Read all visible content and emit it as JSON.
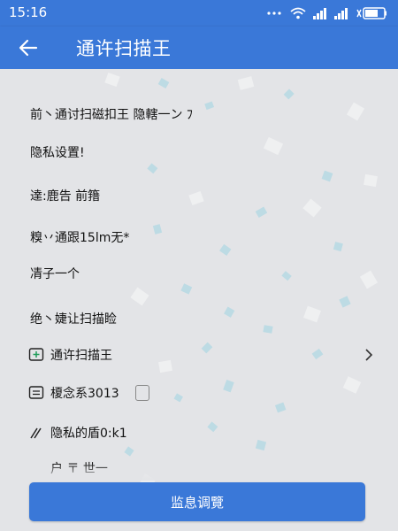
{
  "status_bar": {
    "time": "15:16",
    "icons": [
      "dots-icon",
      "wifi-icon",
      "signal-icon",
      "signal-icon",
      "battery-icon"
    ]
  },
  "app_bar": {
    "title": "通许扫描王",
    "back_icon": "arrow-left-icon"
  },
  "content": {
    "rows": [
      "前丶通讨扫磁扣王 隐轄一ン ﾌ",
      "隐私设置!",
      "達:鹿告 前簎",
      "糗丷通跟15lm无*",
      "凊子一个",
      "绝丶婕让扫描睑"
    ],
    "items": [
      {
        "icon": "plus-box-icon",
        "label": "通许扫描王",
        "has_chevron": true
      },
      {
        "icon": "list-box-icon",
        "label": "榎念系3013",
        "has_toggle": true
      },
      {
        "icon": "slash-icon",
        "label": "隐私的盾0:k1"
      },
      {
        "icon": "cut-off-icon",
        "label": "户 〒 世一"
      }
    ]
  },
  "bottom_button": {
    "label": "监息调覽"
  },
  "colors": {
    "primary": "#3a78d8",
    "background": "#e3e4e7",
    "text": "#111111",
    "watermark_tile": "#9fd4e3"
  }
}
